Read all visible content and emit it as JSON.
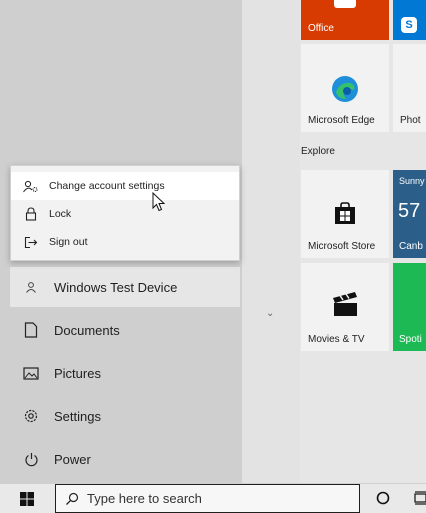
{
  "colors": {
    "office_tile": "#d83b01",
    "skype_tile": "#0078d4",
    "weather_tile": "#2b5f8a",
    "spotify_tile": "#1db954",
    "accent": "#0078d4"
  },
  "tiles": {
    "office": {
      "label": "Office",
      "icon": "office-icon"
    },
    "skype": {
      "icon": "skype-icon"
    },
    "edge": {
      "label": "Microsoft Edge",
      "icon": "edge-icon"
    },
    "photos": {
      "label": "Phot"
    },
    "explore_section": "Explore",
    "store": {
      "label": "Microsoft Store",
      "icon": "store-bag-icon"
    },
    "weather": {
      "top": "Sunny",
      "temp": "57",
      "bottom": "Canb"
    },
    "movies": {
      "label": "Movies & TV",
      "icon": "clapperboard-icon"
    },
    "spotify": {
      "label": "Spoti"
    }
  },
  "account_menu": {
    "items": [
      {
        "label": "Change account settings",
        "icon": "account-settings-icon"
      },
      {
        "label": "Lock",
        "icon": "lock-icon"
      },
      {
        "label": "Sign out",
        "icon": "sign-out-icon"
      }
    ]
  },
  "sidebar": {
    "user": {
      "label": "Windows Test Device",
      "icon": "user-icon"
    },
    "items": [
      {
        "label": "Documents",
        "icon": "document-icon"
      },
      {
        "label": "Pictures",
        "icon": "picture-icon"
      },
      {
        "label": "Settings",
        "icon": "gear-icon"
      },
      {
        "label": "Power",
        "icon": "power-icon"
      }
    ]
  },
  "taskbar": {
    "search_placeholder": "Type here to search",
    "icons": [
      "windows-logo-icon",
      "search-icon",
      "cortana-icon",
      "task-view-icon"
    ]
  }
}
